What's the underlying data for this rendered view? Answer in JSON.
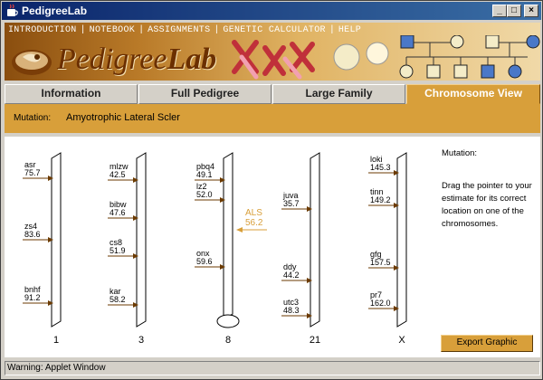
{
  "window": {
    "title": "PedigreeLab"
  },
  "banner": {
    "menu": [
      "INTRODUCTION",
      "NOTEBOOK",
      "ASSIGNMENTS",
      "GENETIC CALCULATOR",
      "HELP"
    ],
    "logo_part1": "Pedigree",
    "logo_part2": "Lab"
  },
  "tabs": [
    {
      "label": "Information",
      "active": false
    },
    {
      "label": "Full Pedigree",
      "active": false
    },
    {
      "label": "Large Family",
      "active": false
    },
    {
      "label": "Chromosome View",
      "active": true
    }
  ],
  "mutation_bar": {
    "label": "Mutation:",
    "value": "Amyotrophic Lateral Scler"
  },
  "instructions": {
    "heading": "Mutation:",
    "body": "Drag the pointer to your estimate for its correct location on one of the chromosomes."
  },
  "export_button": "Export Graphic",
  "status": "Warning: Applet Window",
  "chromosomes": [
    {
      "label": "1",
      "markers": [
        {
          "name": "asr",
          "pos": "75.7"
        },
        {
          "name": "zs4",
          "pos": "83.6"
        },
        {
          "name": "bnhf",
          "pos": "91.2"
        }
      ]
    },
    {
      "label": "3",
      "markers": [
        {
          "name": "mlzw",
          "pos": "42.5"
        },
        {
          "name": "bibw",
          "pos": "47.6"
        },
        {
          "name": "cs8",
          "pos": "51.9"
        },
        {
          "name": "kar",
          "pos": "58.2"
        }
      ]
    },
    {
      "label": "8",
      "markers": [
        {
          "name": "pbq4",
          "pos": "49.1"
        },
        {
          "name": "lz2",
          "pos": "52.0"
        },
        {
          "name": "onx",
          "pos": "59.6"
        }
      ]
    },
    {
      "label": "21",
      "markers": [
        {
          "name": "juva",
          "pos": "35.7"
        },
        {
          "name": "ddy",
          "pos": "44.2"
        },
        {
          "name": "utc3",
          "pos": "48.3"
        }
      ]
    },
    {
      "label": "X",
      "markers": [
        {
          "name": "loki",
          "pos": "145.3"
        },
        {
          "name": "tinn",
          "pos": "149.2"
        },
        {
          "name": "gfg",
          "pos": "157.5"
        },
        {
          "name": "pr7",
          "pos": "162.0"
        }
      ]
    }
  ],
  "pointer": {
    "name": "ALS",
    "pos": "56.2",
    "chromosome": "8"
  },
  "colors": {
    "accent": "#d89f3a",
    "pointer": "#d89f3a",
    "marker": "#6b3a00"
  }
}
